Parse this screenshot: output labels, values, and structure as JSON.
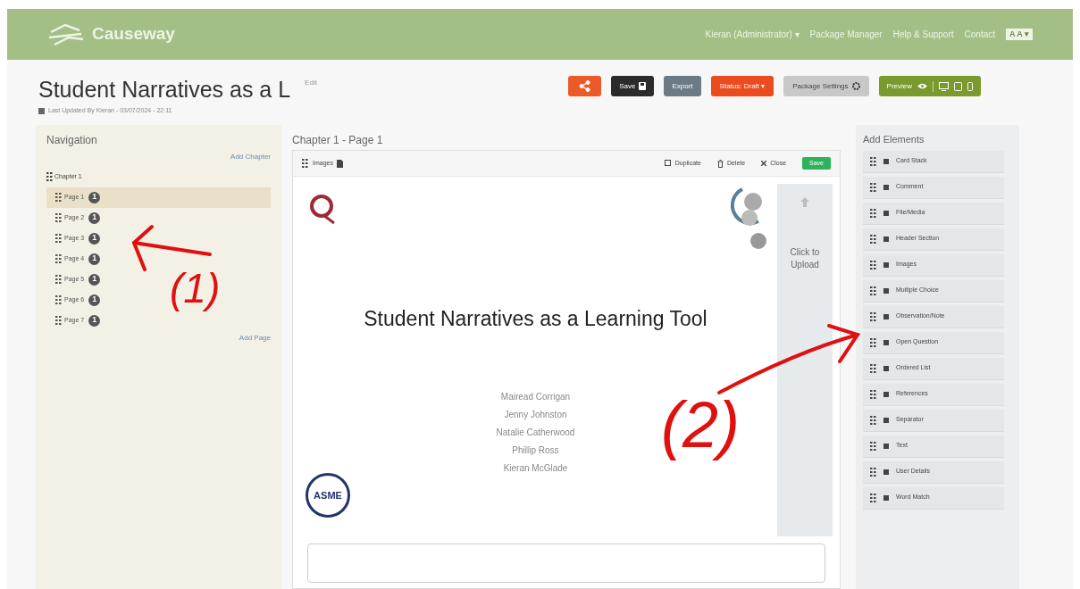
{
  "header": {
    "brand": "Causeway",
    "nav": [
      "Kieran (Administrator) ▾",
      "Package Manager",
      "Help & Support",
      "Contact"
    ],
    "font_toggle": "A A ▾"
  },
  "package": {
    "title": "Student Narratives as a L",
    "edit_link": "Edit",
    "updated": "Last Updated By Kieran - 03/07/2024 - 22:11"
  },
  "toolbar": [
    {
      "kind": "share"
    },
    {
      "kind": "save",
      "label": "Save"
    },
    {
      "kind": "export",
      "label": "Export"
    },
    {
      "kind": "status",
      "label": "Status: Draft ▾"
    },
    {
      "kind": "settings",
      "label": "Package Settings"
    },
    {
      "kind": "preview",
      "label": "Preview"
    }
  ],
  "navigation": {
    "title": "Navigation",
    "add_chapter": "Add Chapter",
    "chapter": "Chapter 1",
    "add_page": "Add Page",
    "pages": [
      {
        "label": "Page 1",
        "badge": "1",
        "selected": true
      },
      {
        "label": "Page 2",
        "badge": "1",
        "selected": false
      },
      {
        "label": "Page 3",
        "badge": "1",
        "selected": false
      },
      {
        "label": "Page 4",
        "badge": "1",
        "selected": false
      },
      {
        "label": "Page 5",
        "badge": "1",
        "selected": false
      },
      {
        "label": "Page 6",
        "badge": "1",
        "selected": false
      },
      {
        "label": "Page 7",
        "badge": "1",
        "selected": false
      }
    ]
  },
  "editor": {
    "heading": "Chapter 1 - Page 1",
    "element_type": "Images",
    "actions": [
      "Duplicate",
      "Delete",
      "Close"
    ],
    "save": "Save",
    "slide": {
      "title": "Student Narratives as a Learning Tool",
      "authors": [
        "Mairead Corrigan",
        "Jenny Johnston",
        "Natalie Catherwood",
        "Phillip Ross",
        "Kieran McGlade"
      ],
      "logo_text": "ASME"
    },
    "upload": "Click to Upload"
  },
  "add_elements": {
    "title": "Add Elements",
    "items": [
      "Card Stack",
      "Comment",
      "File/Media",
      "Header Section",
      "Images",
      "Multiple Choice",
      "Observation/Note",
      "Open Question",
      "Ordered List",
      "References",
      "Separator",
      "Text",
      "User Details",
      "Word Match"
    ]
  },
  "annotations": [
    {
      "label": "(1)"
    },
    {
      "label": "(2)"
    }
  ]
}
